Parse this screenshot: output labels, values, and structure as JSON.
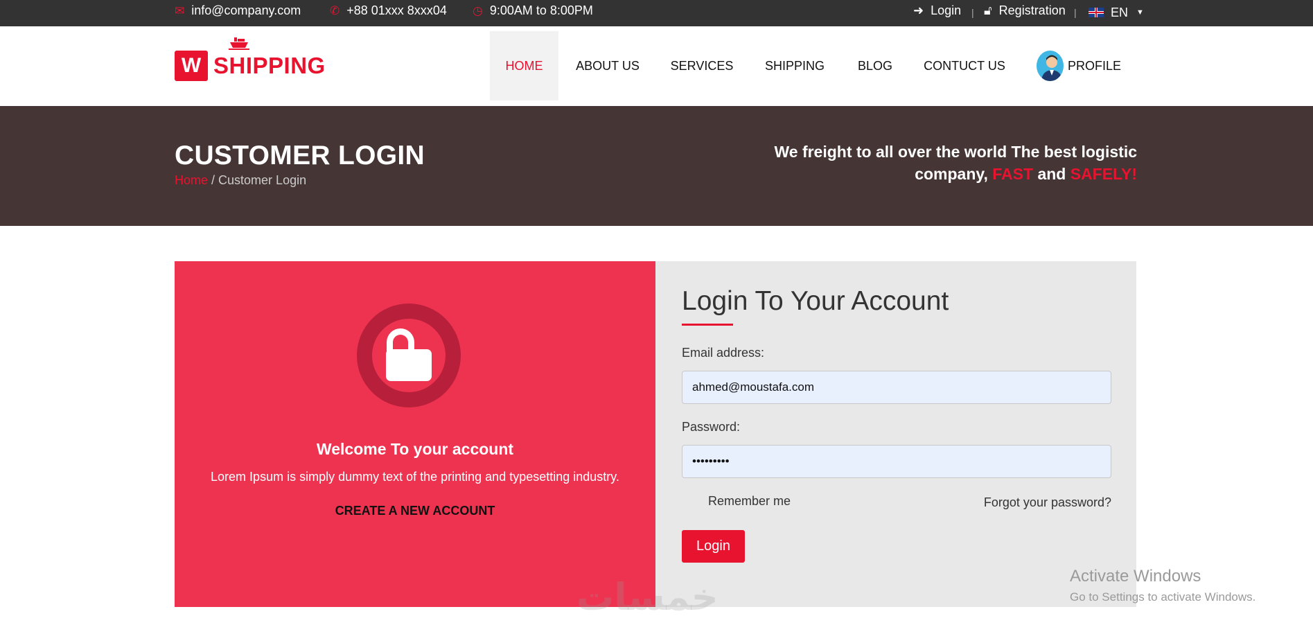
{
  "topbar": {
    "email": "info@company.com",
    "phone": "+88 01xxx 8xxx04",
    "hours": "9:00AM to 8:00PM",
    "login": "Login",
    "registration": "Registration",
    "language": "EN",
    "separator": "|"
  },
  "logo": {
    "mark": "W",
    "name": "SHIPPING"
  },
  "nav": {
    "items": [
      "HOME",
      "ABOUT US",
      "SERVICES",
      "SHIPPING",
      "BLOG",
      "CONTUCT US"
    ],
    "profile": "PROFILE",
    "active": "HOME"
  },
  "banner": {
    "title": "CUSTOMER LOGIN",
    "breadcrumb_home": "Home",
    "breadcrumb_sep": " / ",
    "breadcrumb_current": "Customer Login",
    "tagline_part1": "We freight to all over the world The best logistic company,",
    "tagline_fast": "FAST",
    "tagline_and": "and",
    "tagline_safely": "SAFELY!"
  },
  "welcome": {
    "title": "Welcome To your account",
    "subtitle": "Lorem Ipsum is simply dummy text of the printing and typesetting industry.",
    "create_account": "CREATE A NEW ACCOUNT"
  },
  "form": {
    "title": "Login To Your Account",
    "email_label": "Email address:",
    "email_value": "ahmed@moustafa.com",
    "password_label": "Password:",
    "password_value": "•••••••••",
    "remember": "Remember me",
    "forgot": "Forgot your password?",
    "submit": "Login"
  },
  "overlay": {
    "activate_title": "Activate Windows",
    "activate_sub": "Go to Settings to activate Windows.",
    "watermark": "خمسات"
  },
  "colors": {
    "accent": "#e8132f",
    "topbar": "#333333",
    "banner": "#453535",
    "panel_left": "#ee3351",
    "panel_right": "#e8e8e8"
  }
}
